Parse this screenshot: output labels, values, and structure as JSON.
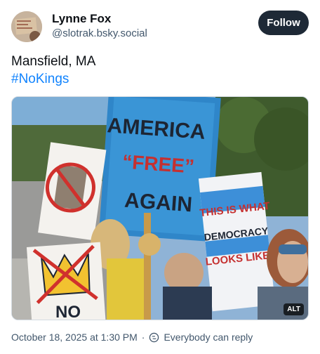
{
  "author": {
    "display_name": "Lynne Fox",
    "handle": "@slotrak.bsky.social",
    "avatar_icon": "avatar-photo"
  },
  "follow_label": "Follow",
  "post": {
    "text": "Mansfield, MA",
    "hashtag": "#NoKings"
  },
  "media": {
    "alt_badge": "ALT",
    "sign_main": [
      "AMERICA",
      "“FREE”",
      "AGAIN"
    ],
    "sign_right": [
      "THIS IS WHAT",
      "DEMOCRACY",
      "LOOKS LIKE"
    ],
    "sign_left_bottom": "NO"
  },
  "meta": {
    "timestamp": "October 18, 2025 at 1:30 PM",
    "reply_setting": "Everybody can reply",
    "reply_icon": "globe-icon"
  },
  "colors": {
    "accent": "#1083fe",
    "follow_bg": "#1e2936",
    "muted_text": "#42576c"
  }
}
